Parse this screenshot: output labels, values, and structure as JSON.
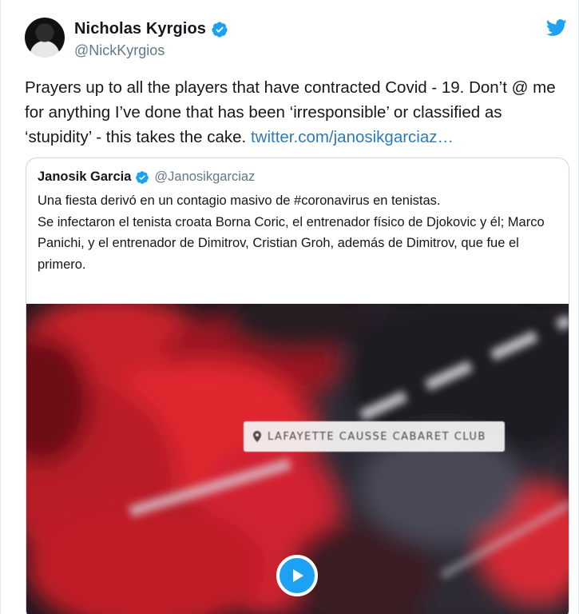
{
  "author": {
    "name": "Nicholas Kyrgios",
    "handle": "@NickKyrgios",
    "verified_icon": "verified-badge-icon"
  },
  "brand": {
    "logo": "twitter-bird-icon",
    "accent": "#1da1f2",
    "link_color": "#2b7bb9"
  },
  "tweet": {
    "text": "Prayers up to all the players that have contracted Covid - 19. Don’t @ me for anything I’ve done that has been ‘irresponsible’ or classified as ‘stupidity’ - this takes the cake. ",
    "link": "twitter.com/janosikgarciaz…"
  },
  "quoted_tweet": {
    "name": "Janosik Garcia",
    "handle": "@Janosikgarciaz",
    "text_lines": [
      "Una fiesta derivó en un contagio masivo de #coronavirus en tenistas.",
      "Se infectaron el tenista croata Borna Coric, el entrenador físico de Djokovic y él; Marco Panichi, y el entrenador de Dimitrov, Cristian Groh, además de Dimitrov, que fue el primero."
    ],
    "media": {
      "location_label": "LAFAYETTE CAUSSE CABARET CLUB",
      "play_icon": "play-icon"
    }
  }
}
